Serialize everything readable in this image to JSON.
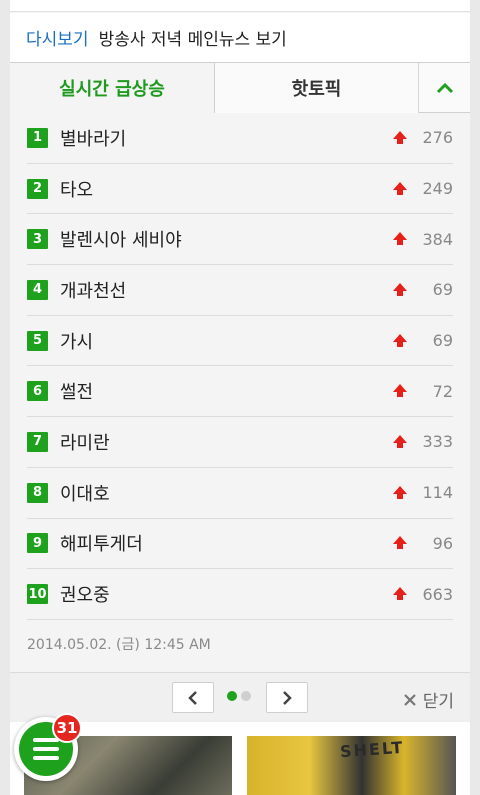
{
  "replay": {
    "link": "다시보기",
    "text": "방송사 저녁 메인뉴스 보기"
  },
  "tabs": [
    {
      "label": "실시간 급상승"
    },
    {
      "label": "핫토픽"
    }
  ],
  "tab_toggle_icon": "chevron-up-icon",
  "trend_list": [
    {
      "rank": "1",
      "term": "별바라기",
      "change": "276"
    },
    {
      "rank": "2",
      "term": "타오",
      "change": "249"
    },
    {
      "rank": "3",
      "term": "발렌시아 세비야",
      "change": "384"
    },
    {
      "rank": "4",
      "term": "개과천선",
      "change": "69"
    },
    {
      "rank": "5",
      "term": "가시",
      "change": "69"
    },
    {
      "rank": "6",
      "term": "썰전",
      "change": "72"
    },
    {
      "rank": "7",
      "term": "라미란",
      "change": "333"
    },
    {
      "rank": "8",
      "term": "이대호",
      "change": "114"
    },
    {
      "rank": "9",
      "term": "해피투게더",
      "change": "96"
    },
    {
      "rank": "10",
      "term": "권오중",
      "change": "663"
    }
  ],
  "timestamp": "2014.05.02. (금) 12:45 AM",
  "pager": {
    "active_page": 1,
    "total_pages": 2,
    "close_label": "닫기"
  },
  "thumb_overlay_text": "SHELT",
  "fab": {
    "icon": "menu-icon",
    "badge": "31"
  },
  "colors": {
    "accent_green": "#1ea21e",
    "link_blue": "#1a6fc4",
    "rise_red": "#e8201c",
    "badge_red": "#e5261f"
  }
}
